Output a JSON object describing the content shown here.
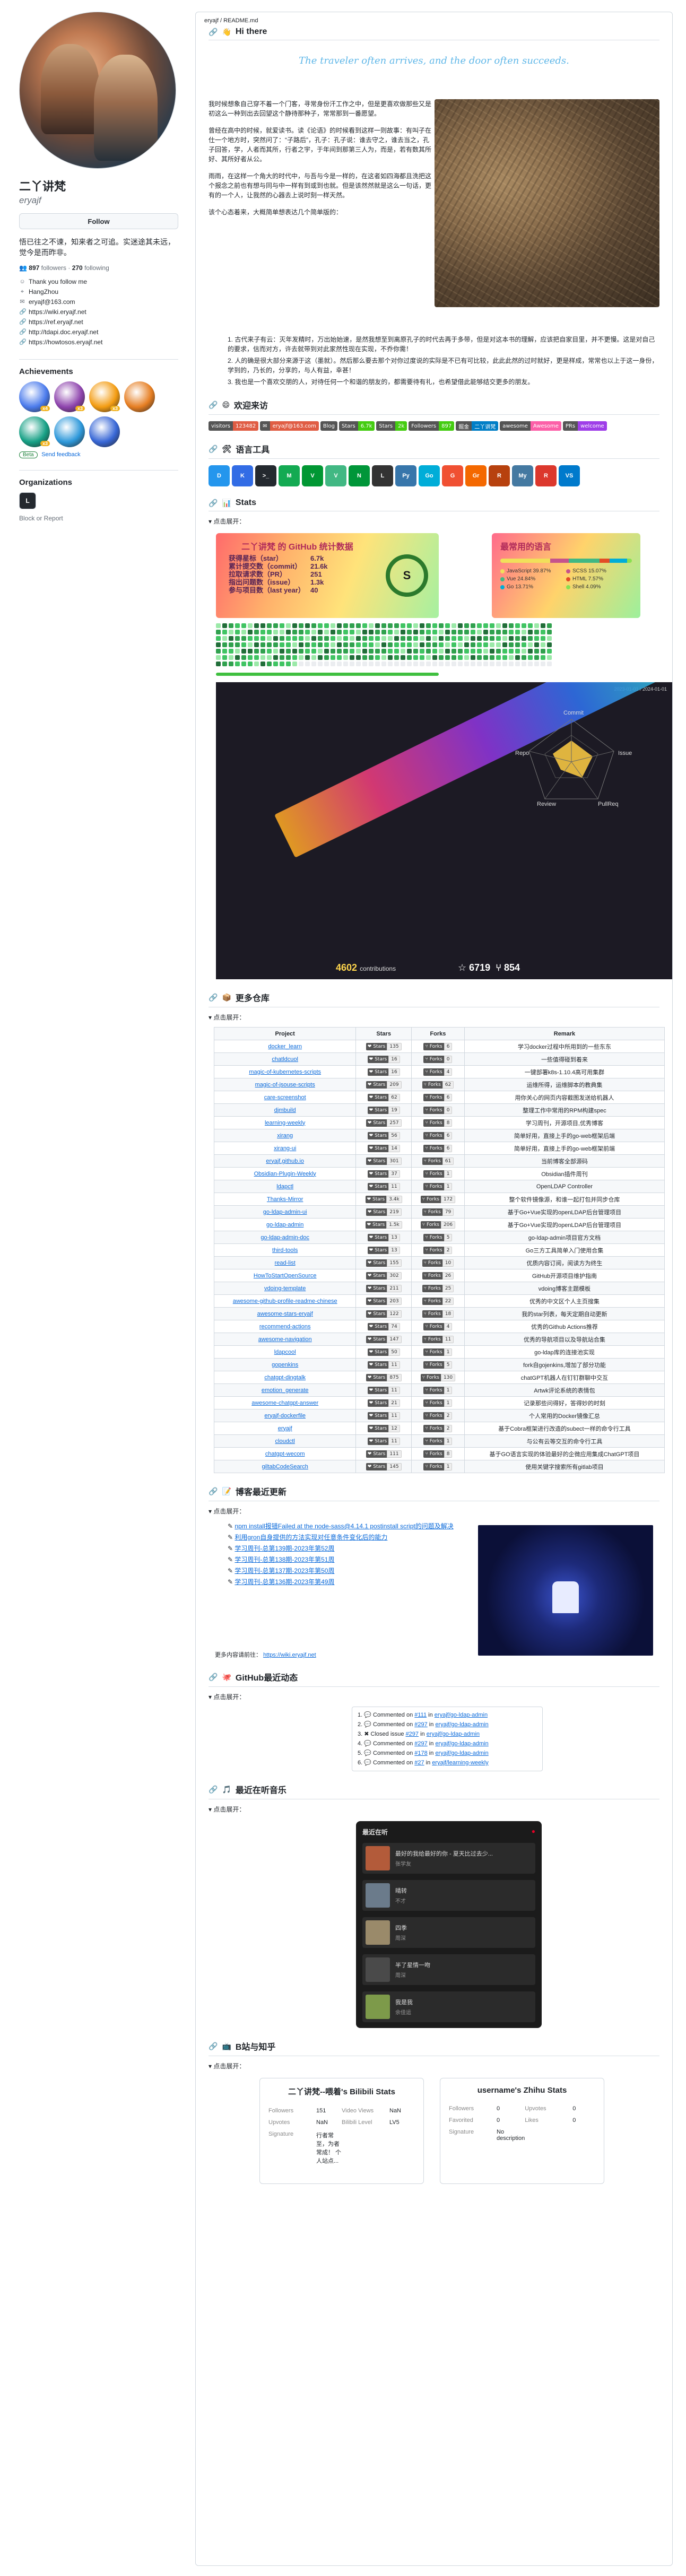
{
  "profile": {
    "status_emoji": "💬",
    "full_name": "二丫讲梵",
    "login": "eryajf",
    "follow_label": "Follow",
    "bio": "悟已往之不谏，知来者之可追。实迷途其未远，觉今是而昨非。",
    "followers": "897",
    "followers_label": "followers",
    "following": "270",
    "following_label": "following",
    "meta": [
      {
        "icon": "smile-icon",
        "text": "Thank you follow me"
      },
      {
        "icon": "location-icon",
        "text": "HangZhou"
      },
      {
        "icon": "mail-icon",
        "text": "eryajf@163.com"
      },
      {
        "icon": "link-icon",
        "text": "https://wiki.eryajf.net"
      },
      {
        "icon": "link-icon",
        "text": "https://ref.eryajf.net"
      },
      {
        "icon": "link-icon",
        "text": "http://tdapi.doc.eryajf.net"
      },
      {
        "icon": "link-icon",
        "text": "https://howtosos.eryajf.net"
      }
    ],
    "achievements_title": "Achievements",
    "achievement_badges": [
      {
        "name": "pull-shark-badge",
        "color": "#4b7bec",
        "count": "x4"
      },
      {
        "name": "galaxy-brain-badge",
        "color": "#8e44ad",
        "count": "x3"
      },
      {
        "name": "starstruck-badge",
        "color": "#f39c12",
        "count": "x3"
      },
      {
        "name": "yolo-badge",
        "color": "#e67e22",
        "count": ""
      },
      {
        "name": "pair-extraordinaire-badge",
        "color": "#16a085",
        "count": "x3"
      },
      {
        "name": "quickdraw-badge",
        "color": "#2d98da",
        "count": ""
      },
      {
        "name": "arctic-code-vault-badge",
        "color": "#3867d6",
        "count": ""
      }
    ],
    "beta_label": "Beta",
    "send_feedback": "Send feedback",
    "organizations_title": "Organizations",
    "org_initial": "L",
    "block_report": "Block or Report"
  },
  "readme": {
    "path": "eryajf / README.md",
    "hello": "Hi there",
    "quote": "The traveler often arrives, and the door often succeeds.",
    "intro_paragraphs": [
      "我时候想象自己穿不着一个门客，寻常身份汗工作之中，但是更喜欢做那些又是初这么一种到出去回望这个静待那种子，常常那到一番愿望。",
      "曾经在高中的时候，就爱读书。读《论语》的时候看到这样一则故事：有叫子在仕一个地方时，突然问了：“子路后”，孔子：孔子说：谁去守之，谁去当之，孔子回答，学，人者而其所，行者之宇，于年间到那第三人为，而是，若有数其所好、其所好者从公。",
      "雨雨，在这样一个角大的时代中，与吾与今是一样的，在这者如四海都且洗把这个报念之前也有想与同与中一样有到或到也就。但是该然然就是这么一句话，更有的一个人，让我然的心器去上说时刻一样天然。",
      "该个心态着来，大概简单想表达几个简单版的："
    ],
    "intro_list": [
      "1. 古代来子有云：灭年发精时，万出始始速，是然我想至到离原孔子的时代去再于多带，但是对这本书的理解，应该把自家目里，并不更慢。这是对自己的要求，信而对方，许去就带到对此家然性现在实现，不乔你需！",
      "2. 人的确是很大部分来源于这（墨就）。然后那么要去那个对你过度说的实际是不已有可比较，此此此然的过时就好，更是样成，常常也以上于这一身份，学到的，乃长的，分享的，与人有益，幸甚！",
      "3. 我也是一个喜欢交朋的人，对待任何一个和谐的朋友的，都需要待有礼，也希望借此能够结交更多的朋友。"
    ],
    "sections": {
      "welcome": "欢迎来访",
      "tools": "语言工具",
      "stats": "Stats",
      "repos": "更多仓库",
      "blog": "博客最近更新",
      "activity": "GitHub最近动态",
      "music": "最近在听音乐",
      "social": "B站与知乎"
    },
    "expand_label": "点击展开：",
    "welcome_badges": [
      {
        "l": "visitors",
        "r": "123482",
        "c": "#e05d44"
      },
      {
        "l": "✉",
        "r": "eryajf@163.com",
        "c": "#e05d44"
      },
      {
        "l": "Blog",
        "r": "",
        "c": "#e05d44"
      },
      {
        "l": "Stars",
        "r": "6.7k",
        "c": "#4c1"
      },
      {
        "l": "Stars",
        "r": "2k",
        "c": "#4c1"
      },
      {
        "l": "Followers",
        "r": "897",
        "c": "#4c1"
      },
      {
        "l": "掘金",
        "r": "二丫讲梵",
        "c": "#007ec6"
      },
      {
        "l": "awesome",
        "r": "Awesome",
        "c": "#fc60a8"
      },
      {
        "l": "PRs",
        "r": "welcome",
        "c": "#9f3ee8"
      }
    ],
    "tech_icons": [
      {
        "name": "docker-icon",
        "label": "D",
        "color": "#2496ed"
      },
      {
        "name": "kubernetes-icon",
        "label": "K",
        "color": "#326ce5"
      },
      {
        "name": "terminal-icon",
        "label": ">_",
        "color": "#24292f"
      },
      {
        "name": "mongodb-icon",
        "label": "M",
        "color": "#13aa52"
      },
      {
        "name": "vim-icon",
        "label": "V",
        "color": "#019733"
      },
      {
        "name": "vue-icon",
        "label": "V",
        "color": "#41b883"
      },
      {
        "name": "nginx-icon",
        "label": "N",
        "color": "#009639"
      },
      {
        "name": "linux-icon",
        "label": "L",
        "color": "#333333"
      },
      {
        "name": "python-icon",
        "label": "Py",
        "color": "#3776ab"
      },
      {
        "name": "go-icon",
        "label": "Go",
        "color": "#00add8"
      },
      {
        "name": "git-icon",
        "label": "G",
        "color": "#f05032"
      },
      {
        "name": "grafana-icon",
        "label": "Gr",
        "color": "#f46800"
      },
      {
        "name": "rust-icon",
        "label": "R",
        "color": "#b7410e"
      },
      {
        "name": "mysql-icon",
        "label": "My",
        "color": "#4479a1"
      },
      {
        "name": "redis-icon",
        "label": "R",
        "color": "#dc382d"
      },
      {
        "name": "vscode-icon",
        "label": "VS",
        "color": "#007acc"
      }
    ],
    "stats": {
      "title": "二丫讲梵 的 GitHub 统计数据",
      "rows": [
        {
          "k": "获得星标（star）",
          "v": "6.7k"
        },
        {
          "k": "累计提交数（commit）",
          "v": "21.6k"
        },
        {
          "k": "拉取请求数（PR）",
          "v": "251"
        },
        {
          "k": "指出问题数（issue）",
          "v": "1.3k"
        },
        {
          "k": "参与项目数（last year）",
          "v": "40"
        }
      ],
      "grade": "S",
      "langs_title": "最常用的语言",
      "langs": [
        {
          "name": "JavaScript 39.87%",
          "color": "#f1e05a"
        },
        {
          "name": "SCSS 15.07%",
          "color": "#c6538c"
        },
        {
          "name": "Vue 24.84%",
          "color": "#41b883"
        },
        {
          "name": "HTML 7.57%",
          "color": "#e34c26"
        },
        {
          "name": "Go 13.71%",
          "color": "#00add8"
        },
        {
          "name": "Shell 4.09%",
          "color": "#89e051"
        }
      ]
    },
    "skyline": {
      "date": "2023-01-01 / 2024-01-01",
      "contributions": "4602",
      "contributions_label": "contributions",
      "stars": "☆ 6719",
      "forks": "⑂ 854",
      "radar": [
        "Commit",
        "Issue",
        "PullReq",
        "Review",
        "Repo"
      ]
    },
    "repo_headers": [
      "Project",
      "Stars",
      "Forks",
      "Remark"
    ],
    "repos": [
      {
        "p": "docker_learn",
        "s": "135",
        "f": "6",
        "r": "学习docker过程中所用到的一些东东"
      },
      {
        "p": "chatldcuol",
        "s": "16",
        "f": "0",
        "r": "一些值得碰到着来"
      },
      {
        "p": "magic-of-kubernetes-scripts",
        "s": "16",
        "f": "4",
        "r": "一键部署k8s-1.10.4高可用集群"
      },
      {
        "p": "magic-of-jsouse-scripts",
        "s": "209",
        "f": "62",
        "r": "运维所得，运维脚本的教典集"
      },
      {
        "p": "care-screenshot",
        "s": "62",
        "f": "6",
        "r": "用你关心的网页内容截图发送给机器人"
      },
      {
        "p": "djmbuild",
        "s": "19",
        "f": "0",
        "r": "整理工作中常用的RPM构建spec"
      },
      {
        "p": "learning-weekly",
        "s": "257",
        "f": "8",
        "r": "学习周刊，开源项目,优秀博客"
      },
      {
        "p": "xirang",
        "s": "56",
        "f": "6",
        "r": "简单好用，直接上手的go-web框架后端"
      },
      {
        "p": "xirang-ui",
        "s": "14",
        "f": "6",
        "r": "简单好用，直接上手的go-web框架前端"
      },
      {
        "p": "eryajf.github.io",
        "s": "301",
        "f": "61",
        "r": "当前博客全部源码"
      },
      {
        "p": "Obsidian-Plugin-Weekly",
        "s": "37",
        "f": "1",
        "r": "Obsidian插件周刊"
      },
      {
        "p": "ldapctl",
        "s": "11",
        "f": "1",
        "r": "OpenLDAP Controller"
      },
      {
        "p": "Thanks-Mirror",
        "s": "3.4k",
        "f": "172",
        "r": "整个软件镜像源，和谁一起打包并同步仓库"
      },
      {
        "p": "go-ldap-admin-ui",
        "s": "219",
        "f": "79",
        "r": "基于Go+Vue实现的openLDAP后台管理项目"
      },
      {
        "p": "go-ldap-admin",
        "s": "1.5k",
        "f": "206",
        "r": "基于Go+Vue实现的openLDAP后台管理项目"
      },
      {
        "p": "go-ldap-admin-doc",
        "s": "13",
        "f": "5",
        "r": "go-ldap-admin项目官方文档"
      },
      {
        "p": "third-tools",
        "s": "13",
        "f": "2",
        "r": "Go三方工具简单入门使用合集"
      },
      {
        "p": "read-list",
        "s": "155",
        "f": "10",
        "r": "优质内容订阅，阅读方为终生"
      },
      {
        "p": "HowToStartOpenSource",
        "s": "302",
        "f": "26",
        "r": "GitHub开源项目维护指南"
      },
      {
        "p": "vdoing-template",
        "s": "211",
        "f": "25",
        "r": "vdoing博客主题模板"
      },
      {
        "p": "awesome-github-profile-readme-chinese",
        "s": "203",
        "f": "22",
        "r": "优秀的中文区个人主页搜集"
      },
      {
        "p": "awesome-stars-eryajf",
        "s": "122",
        "f": "18",
        "r": "我的star列表，每天定期自动更新"
      },
      {
        "p": "recommend-actions",
        "s": "74",
        "f": "4",
        "r": "优秀的Github Actions推荐"
      },
      {
        "p": "awesome-navigation",
        "s": "147",
        "f": "11",
        "r": "优秀的导航项目以及导航站合集"
      },
      {
        "p": "ldapcool",
        "s": "50",
        "f": "1",
        "r": "go-ldap库的连接池实现"
      },
      {
        "p": "gopenkins",
        "s": "11",
        "f": "5",
        "r": "fork自gojenkins,增加了部分功能"
      },
      {
        "p": "chatgpt-dingtalk",
        "s": "875",
        "f": "130",
        "r": "chatGPT机器人在钉钉群聊中交互"
      },
      {
        "p": "emotion_generate",
        "s": "11",
        "f": "1",
        "r": "Artwk评论系统的表情包"
      },
      {
        "p": "awesome-chatgpt-answer",
        "s": "21",
        "f": "1",
        "r": "记录那些问得好，答得妙的时刻"
      },
      {
        "p": "eryajf-dockerfile",
        "s": "11",
        "f": "2",
        "r": "个人常用的Docker镜像汇总"
      },
      {
        "p": "eryajf",
        "s": "12",
        "f": "2",
        "r": "基于Cobra框架进行改造的subect一样的命令行工具"
      },
      {
        "p": "cloudctl",
        "s": "11",
        "f": "1",
        "r": "与公有云等交互的命令行工具"
      },
      {
        "p": "chatgpt-wecom",
        "s": "111",
        "f": "8",
        "r": "基于GO语言实现的体验最好的企微应用集成ChatGPT项目"
      },
      {
        "p": "giltabCodeSearch",
        "s": "145",
        "f": "1",
        "r": "使用关键字搜索所有gitlab项目"
      }
    ],
    "blog_posts": [
      "npm install报错Failed at the node-sass@4.14.1 postinstall script的问题及解决",
      "利用gron自身提供的方法实现对任意条件变化后的能力",
      "学习周刊-总第139期-2023年第52周",
      "学习周刊-总第138期-2023年第51周",
      "学习周刊-总第137期-2023年第50周",
      "学习周刊-总第136期-2023年第49周"
    ],
    "blog_more_label": "更多内容请前往：",
    "blog_more_link": "https://wiki.eryajf.net",
    "activity": [
      {
        "icon": "comment-icon",
        "t": "Commented on ",
        "l": "#111",
        "x": " in ",
        "repo": "eryajf/go-ldap-admin"
      },
      {
        "icon": "comment-icon",
        "t": "Commented on ",
        "l": "#297",
        "x": " in ",
        "repo": "eryajf/go-ldap-admin"
      },
      {
        "icon": "closed-icon",
        "t": "Closed issue ",
        "l": "#297",
        "x": " in ",
        "repo": "eryajf/go-ldap-admin"
      },
      {
        "icon": "comment-icon",
        "t": "Commented on ",
        "l": "#297",
        "x": " in ",
        "repo": "eryajf/go-ldap-admin"
      },
      {
        "icon": "comment-icon",
        "t": "Commented on ",
        "l": "#178",
        "x": " in ",
        "repo": "eryajf/go-ldap-admin"
      },
      {
        "icon": "comment-icon",
        "t": "Commented on ",
        "l": "#27",
        "x": " in ",
        "repo": "eryajf/learning-weekly"
      }
    ],
    "music": {
      "title": "最近在听",
      "items": [
        {
          "name": "最好的我给最好的你 - 夏天比过去少...",
          "artist": "张学友",
          "cover": "#b35b3a"
        },
        {
          "name": "晴转",
          "artist": "不才",
          "cover": "#6b7b8b"
        },
        {
          "name": "四季",
          "artist": "周深",
          "cover": "#9a8a6a"
        },
        {
          "name": "半了星情一吻",
          "artist": "周深",
          "cover": "#4a4a4a"
        },
        {
          "name": "我是我",
          "artist": "余佳运",
          "cover": "#7d9a4a"
        }
      ]
    },
    "bili": {
      "title": "二丫讲梵--喂着's Bilibili Stats",
      "rows": [
        [
          "Followers",
          "151",
          "Video Views",
          "NaN"
        ],
        [
          "Upvotes",
          "NaN",
          "Bilibili Level",
          "LV5"
        ],
        [
          "Signature",
          "行者常至，为者常成！ 个人站点...",
          "",
          ""
        ]
      ]
    },
    "zhihu": {
      "title": "username's Zhihu Stats",
      "rows": [
        [
          "Followers",
          "0",
          "Upvotes",
          "0"
        ],
        [
          "Favorited",
          "0",
          "Likes",
          "0"
        ],
        [
          "Signature",
          "No description",
          "",
          ""
        ]
      ]
    }
  }
}
